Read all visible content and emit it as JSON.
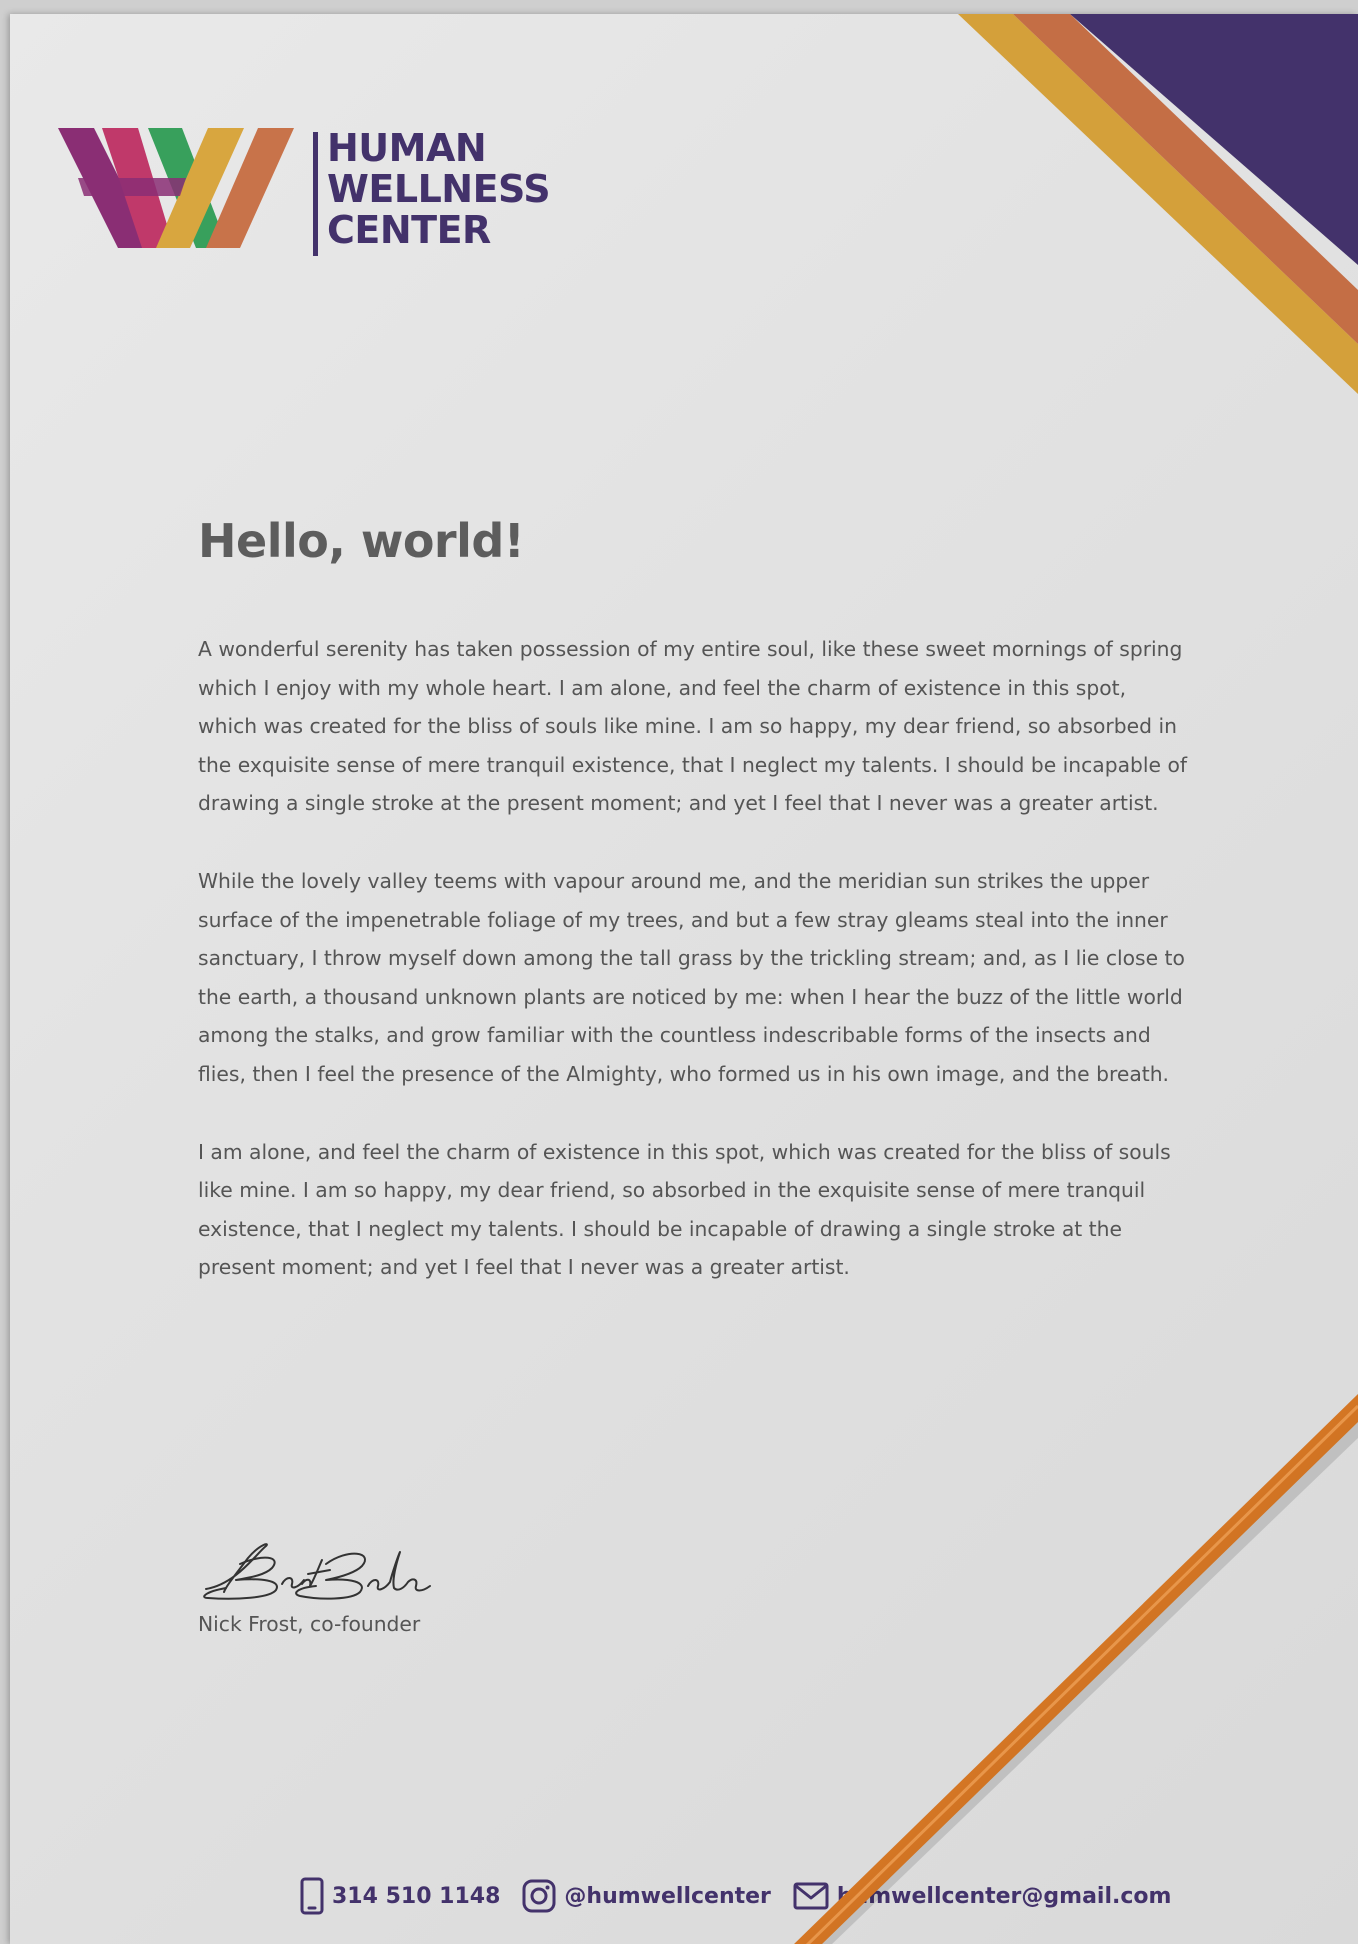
{
  "logo": {
    "line1": "HUMAN",
    "line2": "WELLNESS",
    "line3": "CENTER"
  },
  "colors": {
    "brand_purple": "#43326b",
    "stripe_gold": "#d4a03a",
    "stripe_orange": "#c46e45",
    "logo_magenta": "#c0396a",
    "logo_green": "#38a05c",
    "logo_plum": "#8a2e74",
    "logo_gold": "#d8a63f",
    "logo_rust": "#c8734a",
    "pencil": "#c8661a"
  },
  "letter": {
    "title": "Hello, world!",
    "paragraphs": [
      "A wonderful serenity has taken possession of my entire soul, like these sweet mornings of spring which I enjoy with my whole heart. I am alone, and feel the charm of existence in this spot, which was created for the bliss of souls like mine. I am so happy, my dear friend, so absorbed in the exquisite sense of mere tranquil existence, that I neglect my talents. I should be incapable of drawing a single stroke at the present moment; and yet I feel that I never was a greater artist.",
      "While the lovely valley teems with vapour around me, and the meridian sun strikes the upper surface of the impenetrable foliage of my trees, and but a few stray gleams steal into the inner sanctuary, I throw myself down among the tall grass by the trickling stream; and, as I lie close to the earth, a thousand unknown plants are noticed by me: when I hear the buzz of the little world among the stalks, and grow familiar with the countless indescribable forms of the insects and flies, then I feel the presence of the Almighty, who formed us in his own image, and the breath.",
      "I am alone, and feel the charm of existence in this spot, which was created for the bliss of souls like mine. I am so happy, my dear friend, so absorbed in the exquisite sense of mere tranquil existence, that I neglect my talents. I should be incapable of drawing a single stroke at the present moment; and yet I feel that I never was a greater artist."
    ],
    "signer": "Nick Frost, co-founder"
  },
  "footer": {
    "phone": "314 510 1148",
    "phone_icon": "phone-icon",
    "instagram": "@humwellcenter",
    "instagram_icon": "instagram-icon",
    "email": "humwellcenter@gmail.com",
    "email_icon": "mail-icon"
  }
}
